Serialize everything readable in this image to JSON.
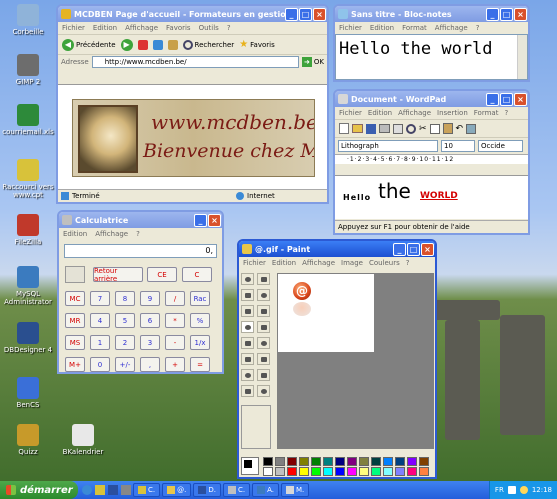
{
  "desktop_icons": [
    {
      "label": "Corbeille",
      "icon": "recycle-bin-icon",
      "color": "#8fb3d9"
    },
    {
      "label": "GIMP 2",
      "icon": "gimp-icon",
      "color": "#6d6d6d"
    },
    {
      "label": "courriemail.xls",
      "icon": "excel-file-icon",
      "color": "#2d8a3a"
    },
    {
      "label": "Raccourci vers www.cpt",
      "icon": "shortcut-icon",
      "color": "#d8c23a"
    },
    {
      "label": "FileZilla",
      "icon": "filezilla-icon",
      "color": "#c0392b"
    },
    {
      "label": "MySQL Administrator",
      "icon": "mysql-icon",
      "color": "#3b7bbf"
    },
    {
      "label": "DBDesigner 4",
      "icon": "dbdesigner-icon",
      "color": "#2a4f8f"
    },
    {
      "label": "BenCS",
      "icon": "bencs-icon",
      "color": "#3a6fd8"
    },
    {
      "label": "Quizz",
      "icon": "quizz-icon",
      "color": "#c79a2a"
    },
    {
      "label": "BKalendrier",
      "icon": "calendar-icon",
      "color": "#e8e8e8"
    }
  ],
  "ie": {
    "title": "MCDBEN  Page d'accueil - Formateurs en gestion...",
    "menu": [
      "Fichier",
      "Edition",
      "Affichage",
      "Favoris",
      "Outils",
      "?"
    ],
    "toolbar": {
      "back": "Précédente",
      "search": "Rechercher",
      "favorites": "Favoris"
    },
    "address_label": "Adresse",
    "url": "http://www.mcdben.be/",
    "go": "OK",
    "banner_line1": "www.mcdben.be",
    "banner_line2": "Bienvenue chez M",
    "status_left": "Terminé",
    "status_right": "Internet"
  },
  "notepad": {
    "title": "Sans titre - Bloc-notes",
    "menu": [
      "Fichier",
      "Edition",
      "Format",
      "Affichage",
      "?"
    ],
    "content": "Hello the world"
  },
  "wordpad": {
    "title": "Document - WordPad",
    "menu": [
      "Fichier",
      "Edition",
      "Affichage",
      "Insertion",
      "Format",
      "?"
    ],
    "font": "Lithograph",
    "size": "10",
    "script": "Occide",
    "ruler": "·1·2·3·4·5·6·7·8·9·10·11·12",
    "text_hello": "Hello",
    "text_the": "the",
    "text_world": "WORLD",
    "status": "Appuyez sur F1 pour obtenir de l'aide"
  },
  "calc": {
    "title": "Calculatrice",
    "menu": [
      "Edition",
      "Affichage",
      "?"
    ],
    "display": "0,",
    "top_buttons": [
      "Retour arrière",
      "CE",
      "C"
    ],
    "rows": [
      [
        "MC",
        "7",
        "8",
        "9",
        "/",
        "Rac"
      ],
      [
        "MR",
        "4",
        "5",
        "6",
        "*",
        "%"
      ],
      [
        "MS",
        "1",
        "2",
        "3",
        "-",
        "1/x"
      ],
      [
        "M+",
        "0",
        "+/-",
        ",",
        "+",
        "="
      ]
    ]
  },
  "paint": {
    "title": "@.gif - Paint",
    "menu": [
      "Fichier",
      "Edition",
      "Affichage",
      "Image",
      "Couleurs",
      "?"
    ],
    "palette": [
      "#000000",
      "#808080",
      "#800000",
      "#808000",
      "#008000",
      "#008080",
      "#000080",
      "#800080",
      "#808040",
      "#004040",
      "#0080ff",
      "#004080",
      "#8000ff",
      "#804000",
      "#ffffff",
      "#c0c0c0",
      "#ff0000",
      "#ffff00",
      "#00ff00",
      "#00ffff",
      "#0000ff",
      "#ff00ff",
      "#ffff80",
      "#00ff80",
      "#80ffff",
      "#8080ff",
      "#ff0080",
      "#ff8040"
    ]
  },
  "taskbar": {
    "start": "démarrer",
    "items": [
      "C.",
      "@.",
      "D.",
      "C.",
      "A.",
      "M."
    ],
    "lang": "FR",
    "clock": "12:18"
  }
}
